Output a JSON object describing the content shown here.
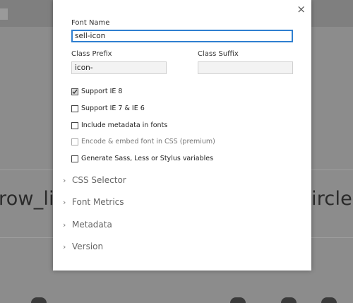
{
  "background": {
    "left_text": "row_li",
    "right_text": "ircle"
  },
  "modal": {
    "close_glyph": "×",
    "font_name": {
      "label": "Font Name",
      "value": "sell-icon"
    },
    "class_prefix": {
      "label": "Class Prefix",
      "value": "icon-"
    },
    "class_suffix": {
      "label": "Class Suffix",
      "value": ""
    },
    "options": [
      {
        "label": "Support IE 8",
        "checked": true,
        "disabled": false
      },
      {
        "label": "Support IE 7 & IE 6",
        "checked": false,
        "disabled": false
      },
      {
        "label": "Include metadata in fonts",
        "checked": false,
        "disabled": false
      },
      {
        "label": "Encode & embed font in CSS  (premium)",
        "checked": false,
        "disabled": true
      },
      {
        "label": "Generate Sass, Less or Stylus variables",
        "checked": false,
        "disabled": false
      }
    ],
    "sections": [
      {
        "label": "CSS Selector",
        "icon": "chevron-right-icon"
      },
      {
        "label": "Font Metrics",
        "icon": "chevron-right-icon"
      },
      {
        "label": "Metadata",
        "icon": "chevron-right-icon"
      },
      {
        "label": "Version",
        "icon": "chevron-right-icon"
      }
    ]
  }
}
